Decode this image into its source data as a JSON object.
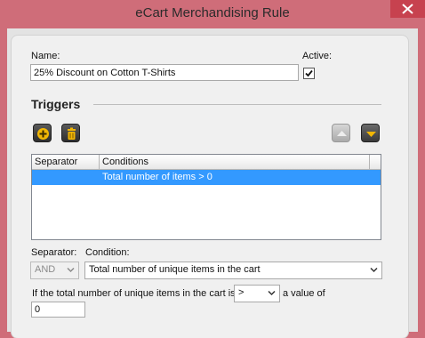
{
  "window": {
    "title": "eCart Merchandising Rule",
    "accent": "#cf6d79",
    "close_color": "#c7424f"
  },
  "form": {
    "name_label": "Name:",
    "name_value": "25% Discount on Cotton T-Shirts",
    "active_label": "Active:",
    "active_checked": true
  },
  "triggers": {
    "title": "Triggers",
    "buttons": {
      "add": "plus-icon",
      "delete": "trash-icon",
      "move_up": "arrow-up-icon",
      "move_down": "arrow-down-icon"
    },
    "columns": [
      "Separator",
      "Conditions"
    ],
    "rows": [
      {
        "separator": "",
        "condition": "Total number of items > 0",
        "selected": true
      }
    ]
  },
  "editor": {
    "separator_label": "Separator:",
    "separator_value": "AND",
    "condition_label": "Condition:",
    "condition_value": "Total number of unique items in the cart",
    "sentence_prefix": "If the total number of unique items in the cart is",
    "operator_value": ">",
    "sentence_suffix": "a value of",
    "value": "0"
  }
}
